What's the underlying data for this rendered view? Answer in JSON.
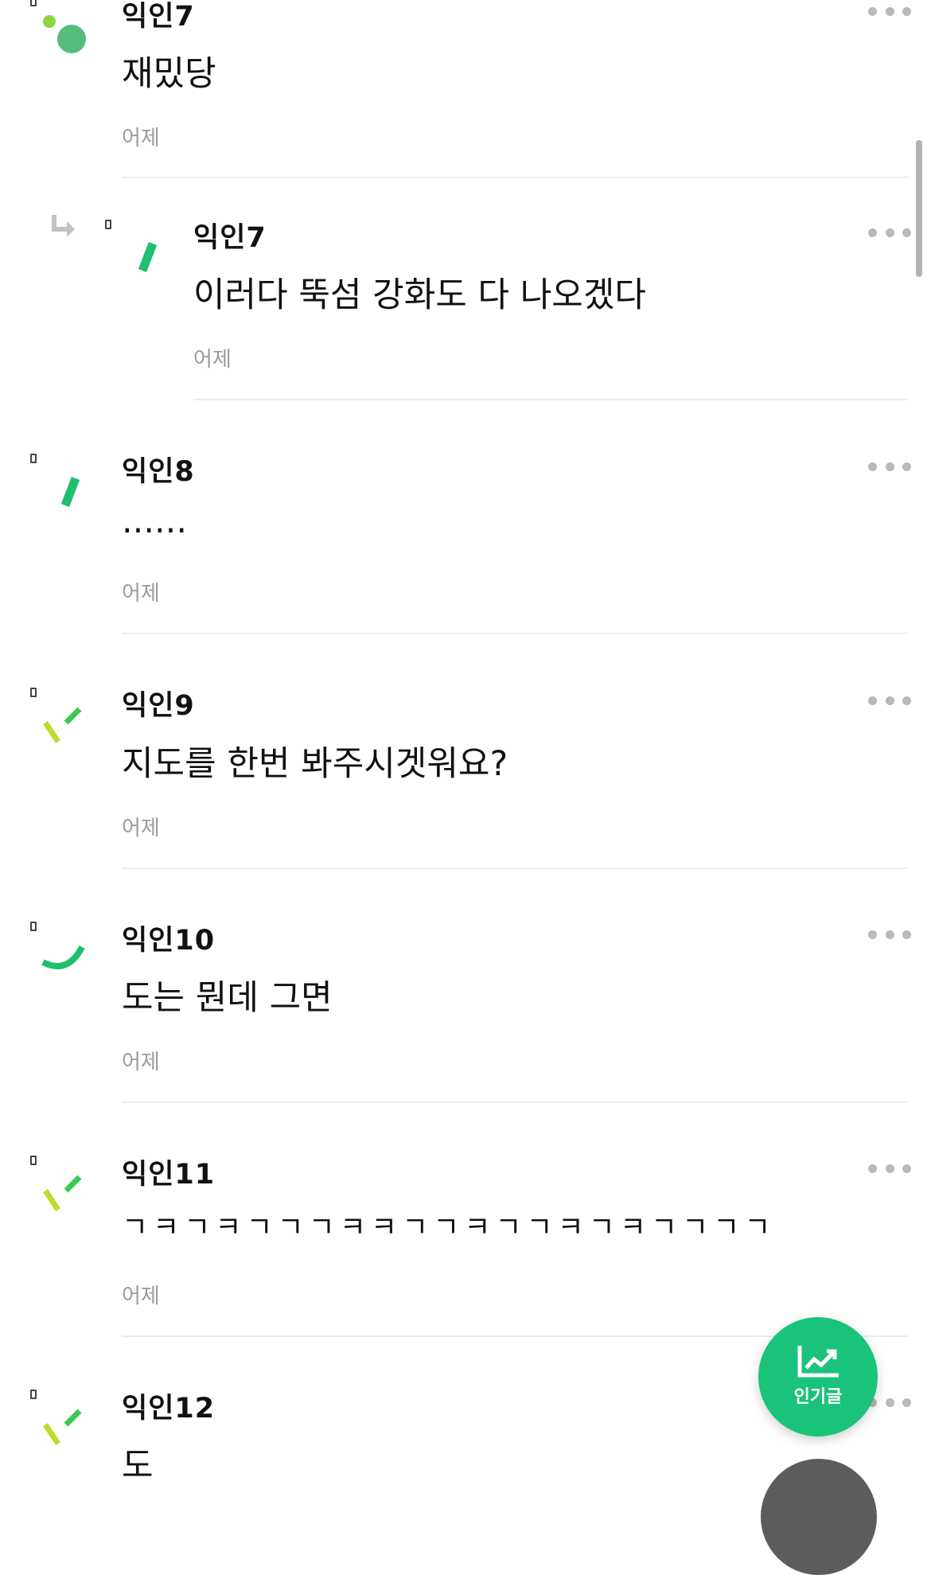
{
  "comments": [
    {
      "author": "익인7",
      "text": "재밌당",
      "time": "어제",
      "avatar": "dots"
    },
    {
      "author": "익인7",
      "text": "이러다 뚝섬 강화도 다 나오겠다",
      "time": "어제",
      "avatar": "slash",
      "reply": true
    },
    {
      "author": "익인8",
      "text": "......",
      "time": "어제",
      "avatar": "slash"
    },
    {
      "author": "익인9",
      "text": "지도를 한번 봐주시겟워요?",
      "time": "어제",
      "avatar": "double"
    },
    {
      "author": "익인10",
      "text": "도는 뭔데 그면",
      "time": "어제",
      "avatar": "smile"
    },
    {
      "author": "익인11",
      "text": "ㄱㅋㄱㅋㄱㄱㄱㅋㅋㄱㄱㅋㄱㄱㅋㄱㅋㄱㄱㄱㄱ",
      "time": "어제",
      "avatar": "double"
    },
    {
      "author": "익인12",
      "text": "도",
      "time": "",
      "avatar": "double"
    }
  ],
  "fab": {
    "popular_label": "인기글",
    "popular_icon": "trend-chart-icon"
  },
  "colors": {
    "accent": "#19c37a",
    "avatar_green": "#1fbf6e",
    "avatar_lime": "#c3d92c",
    "timestamp": "#9a9a9a",
    "divider": "#ececec"
  }
}
